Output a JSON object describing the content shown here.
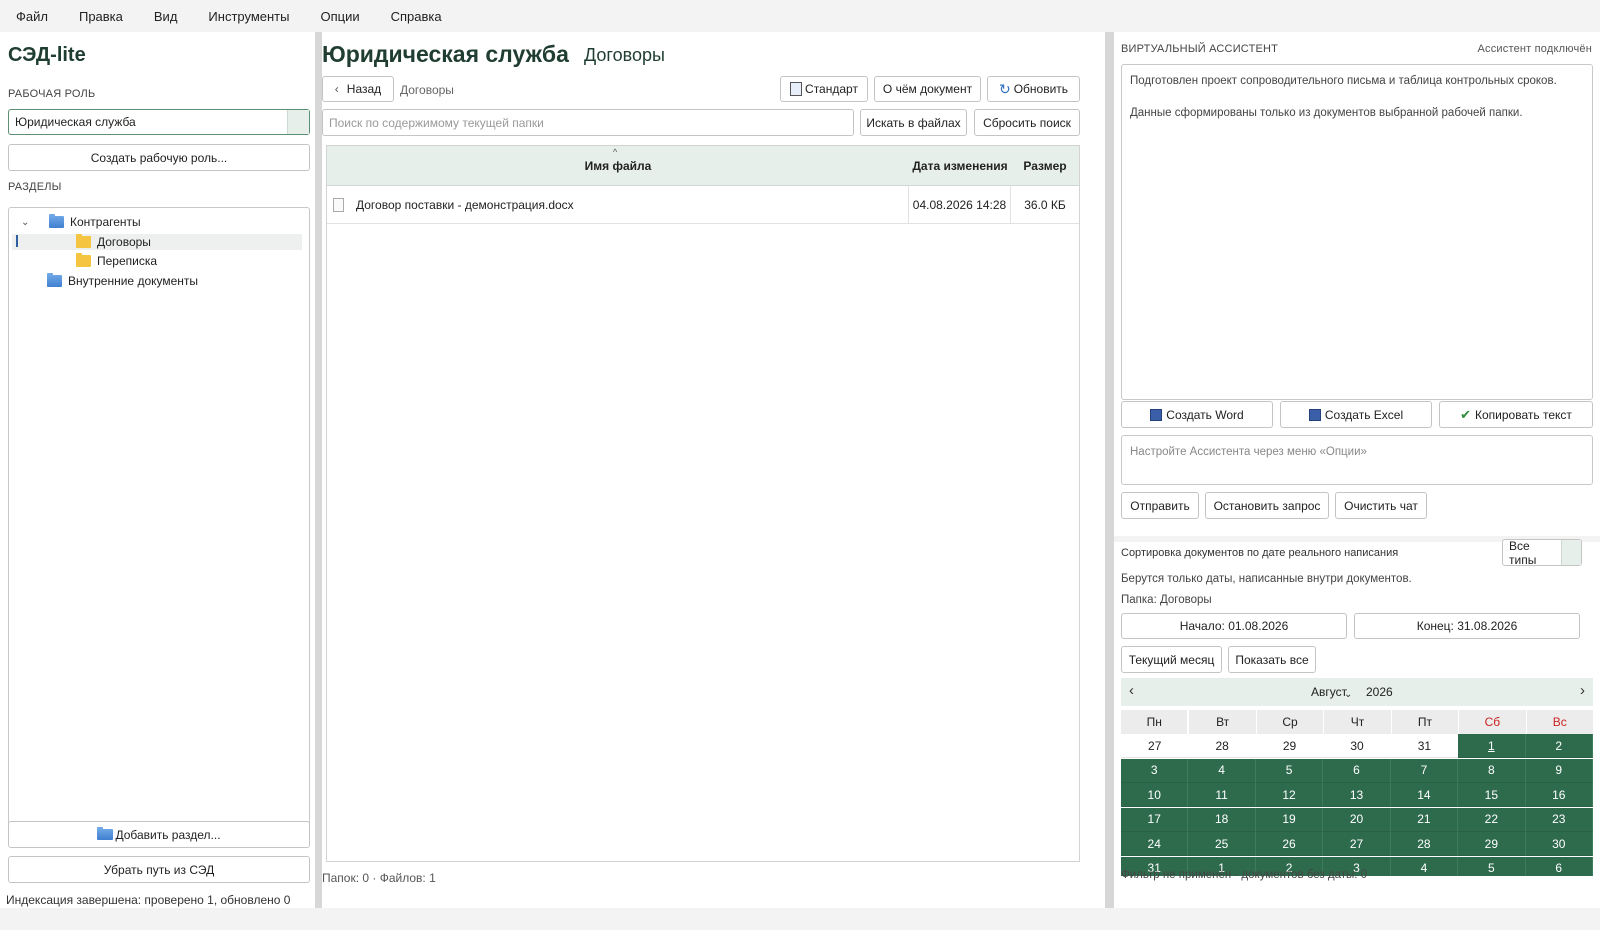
{
  "menu": [
    "Файл",
    "Правка",
    "Вид",
    "Инструменты",
    "Опции",
    "Справка"
  ],
  "left": {
    "app_title": "СЭД-lite",
    "role_label": "РАБОЧАЯ РОЛЬ",
    "role_value": "Юридическая служба",
    "create_role_button": "Создать рабочую роль...",
    "sections_label": "РАЗДЕЛЫ",
    "tree": [
      {
        "label": "Контрагенты",
        "level": 0,
        "icon": "folder-blue-icon",
        "expanded": true
      },
      {
        "label": "Договоры",
        "level": 1,
        "icon": "folder-yellow-icon",
        "selected": true
      },
      {
        "label": "Переписка",
        "level": 1,
        "icon": "folder-yellow-icon"
      },
      {
        "label": "Внутренние документы",
        "level": 0,
        "icon": "folder-blue-icon"
      }
    ],
    "add_section_button": "Добавить раздел...",
    "remove_path_button": "Убрать путь из СЭД"
  },
  "center": {
    "title": "Юридическая служба",
    "subtitle": "Договоры",
    "back_button": "Назад",
    "breadcrumb": "Договоры",
    "standard_button": "Стандарт",
    "about_button": "О чём документ",
    "refresh_button": "Обновить",
    "search_placeholder": "Поиск по содержимому текущей папки",
    "search_button": "Искать в файлах",
    "reset_search_button": "Сбросить поиск",
    "columns": {
      "name": "Имя файла",
      "date": "Дата изменения",
      "size": "Размер"
    },
    "files": [
      {
        "name": "Договор поставки - демонстрация.docx",
        "date": "04.08.2026 14:28",
        "size": "36.0 КБ"
      }
    ],
    "status": "Папок: 0 · Файлов: 1"
  },
  "assistant": {
    "label": "ВИРТУАЛЬНЫЙ АССИСТЕНТ",
    "status": "Ассистент подключён",
    "message1": "Подготовлен проект сопроводительного письма и таблица контрольных сроков.",
    "message2": "Данные сформированы только из документов выбранной рабочей папки.",
    "create_word": "Создать Word",
    "create_excel": "Создать Excel",
    "copy_text": "Копировать текст",
    "input_placeholder": "Настройте Ассистента через меню «Опции»",
    "send": "Отправить",
    "stop": "Остановить запрос",
    "clear": "Очистить чат"
  },
  "sorting": {
    "title": "Сортировка документов по дате реального написания",
    "type_select": "Все типы",
    "note": "Берутся только даты, написанные внутри документов.",
    "folder": "Папка: Договоры",
    "start": "Начало: 01.08.2026",
    "end": "Конец: 31.08.2026",
    "current_month": "Текущий месяц",
    "show_all": "Показать все",
    "calendar": {
      "month": "Август",
      "year": "2026",
      "weekdays": [
        "Пн",
        "Вт",
        "Ср",
        "Чт",
        "Пт",
        "Сб",
        "Вс"
      ],
      "weeks": [
        [
          "27",
          "28",
          "29",
          "30",
          "31",
          "1",
          "2"
        ],
        [
          "3",
          "4",
          "5",
          "6",
          "7",
          "8",
          "9"
        ],
        [
          "10",
          "11",
          "12",
          "13",
          "14",
          "15",
          "16"
        ],
        [
          "17",
          "18",
          "19",
          "20",
          "21",
          "22",
          "23"
        ],
        [
          "24",
          "25",
          "26",
          "27",
          "28",
          "29",
          "30"
        ],
        [
          "31",
          "1",
          "2",
          "3",
          "4",
          "5",
          "6"
        ]
      ],
      "selected_color": "#2e6b4d",
      "weekend_color": "#cc2222"
    },
    "filter_status": "Фильтр не применён · документов без даты: 0"
  },
  "statusbar": "Индексация завершена: проверено 1, обновлено 0",
  "colors": {
    "accent": "#2e6b4d",
    "header_bg": "#e6efe9",
    "title": "#1f3d30"
  }
}
